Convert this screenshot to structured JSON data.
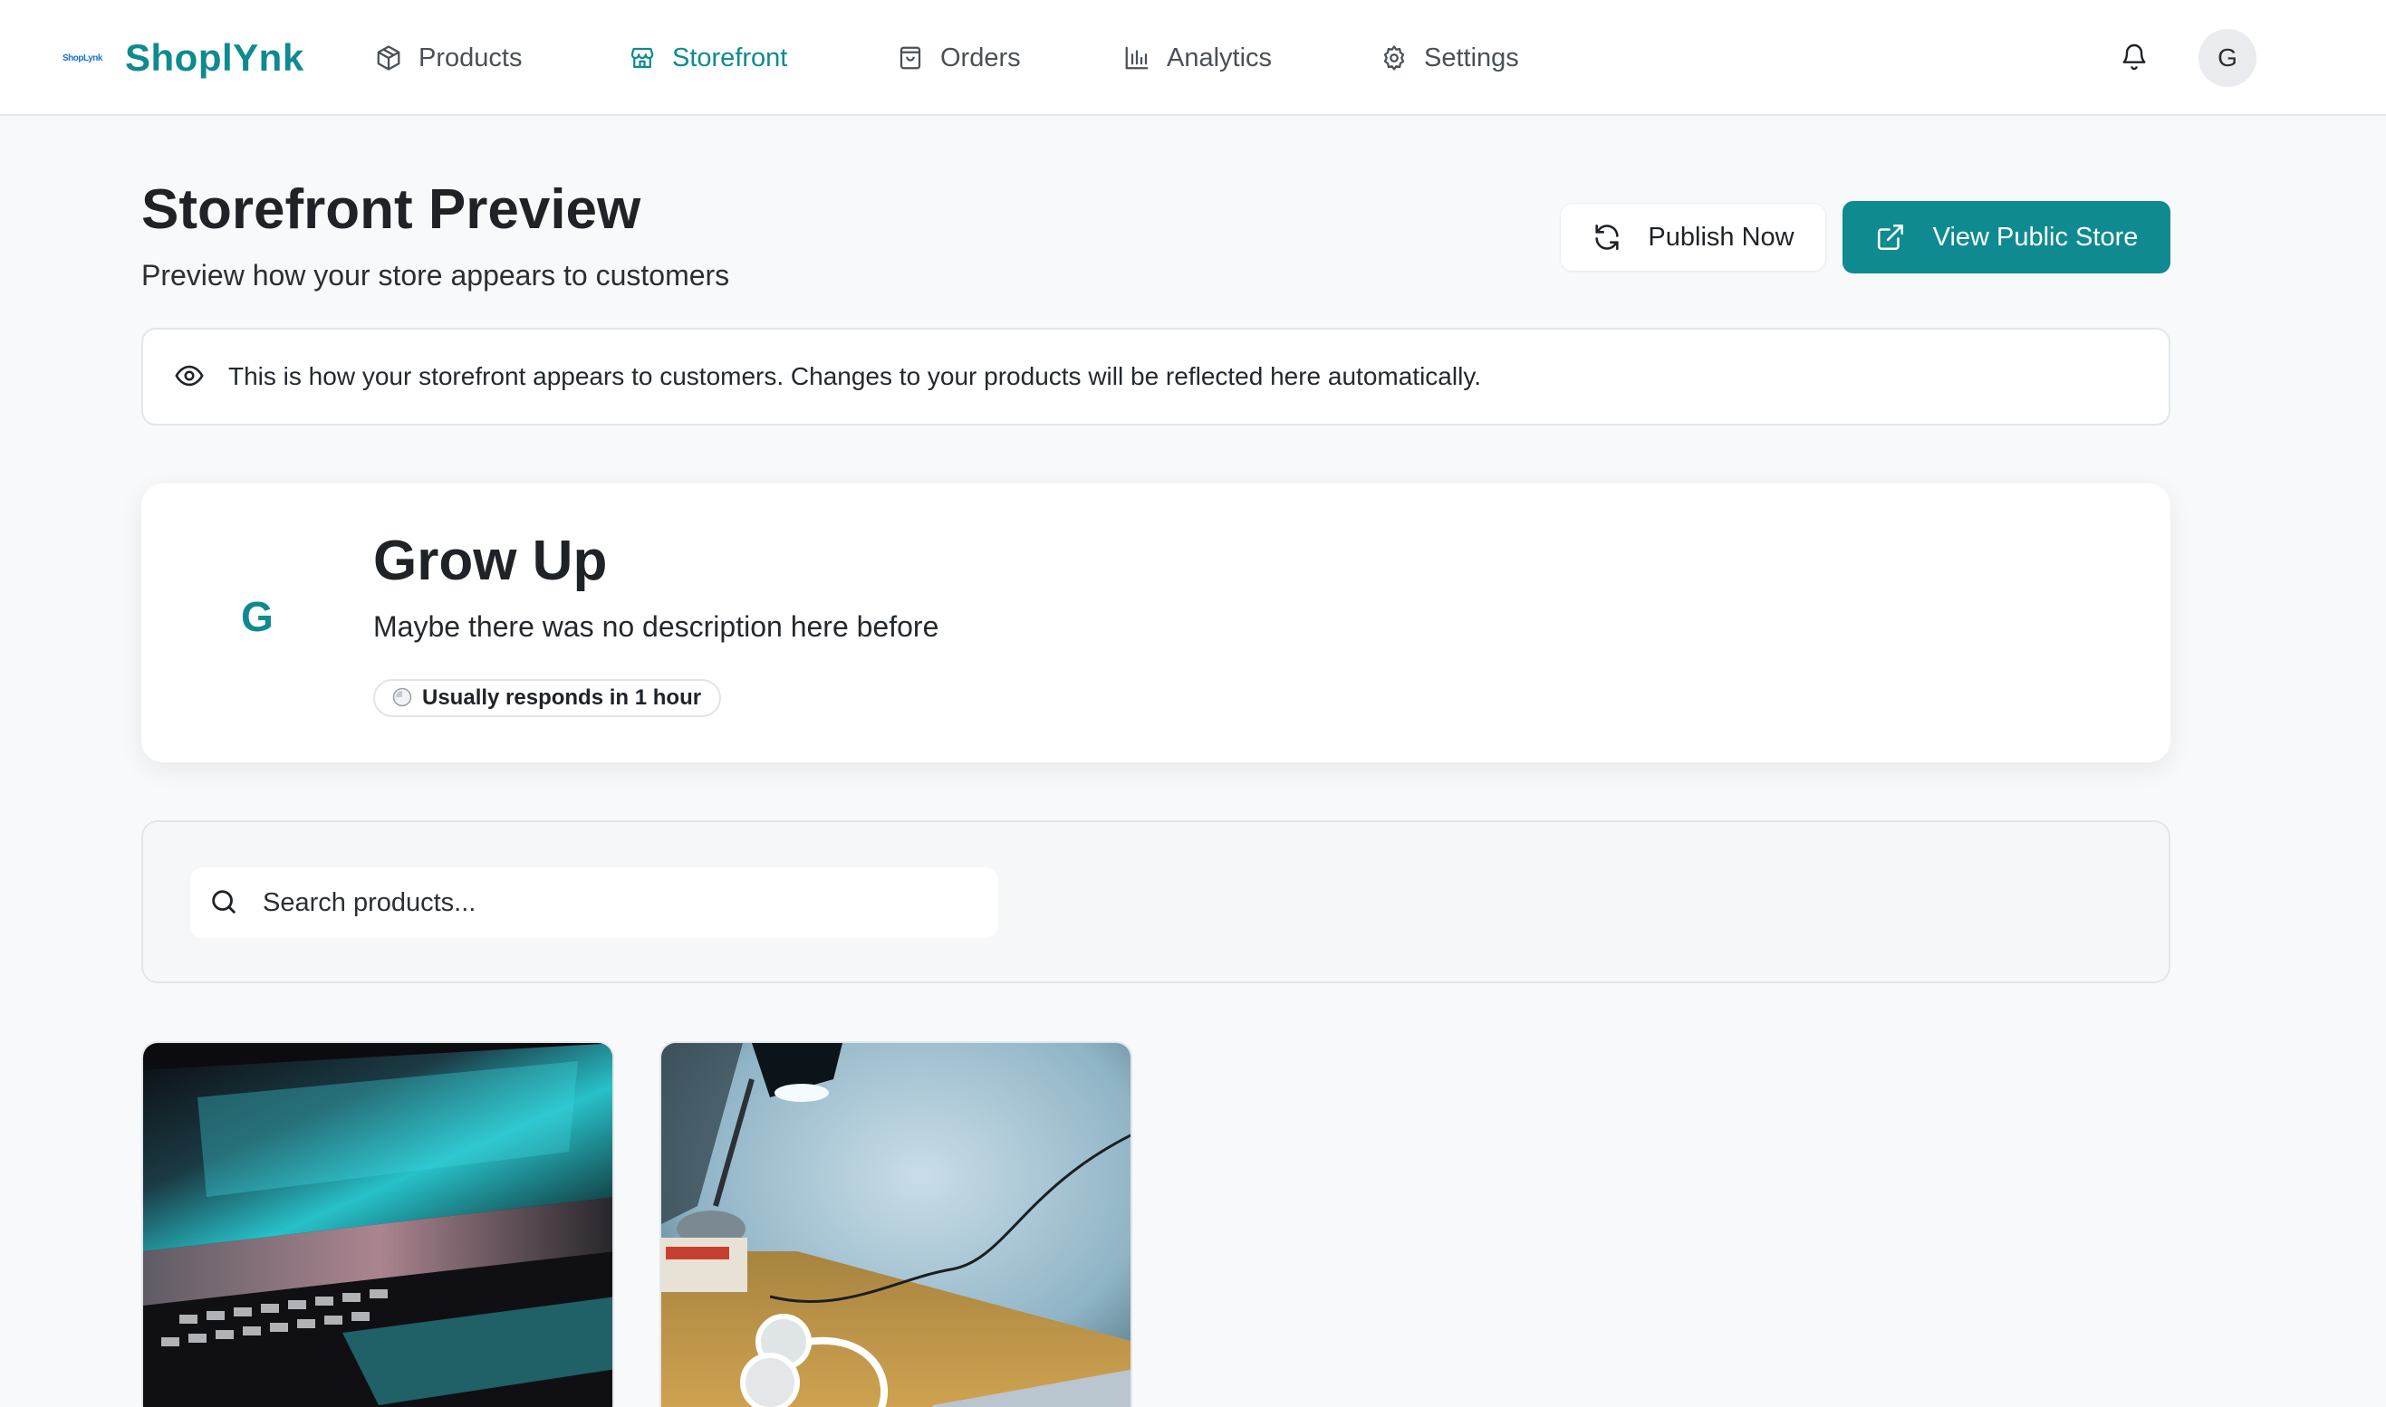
{
  "brand": {
    "name": "ShoplYnk",
    "mark": "ShopLynk"
  },
  "nav": [
    {
      "label": "Products",
      "icon": "package-icon",
      "active": false
    },
    {
      "label": "Storefront",
      "icon": "store-icon",
      "active": true
    },
    {
      "label": "Orders",
      "icon": "shopping-bag-icon",
      "active": false
    },
    {
      "label": "Analytics",
      "icon": "bar-chart-icon",
      "active": false
    },
    {
      "label": "Settings",
      "icon": "gear-icon",
      "active": false
    }
  ],
  "user": {
    "initial": "G"
  },
  "page": {
    "title": "Storefront Preview",
    "subtitle": "Preview how your store appears to customers",
    "publish_label": "Publish Now",
    "view_label": "View Public Store",
    "notice": "This is how your storefront appears to customers. Changes to your products will be reflected here automatically."
  },
  "store": {
    "initial": "G",
    "name": "Grow Up",
    "description": "Maybe there was no description here before",
    "response_badge": "Usually responds in 1 hour"
  },
  "search": {
    "placeholder": "Search products..."
  },
  "products": [
    {
      "image": "laptop-photo"
    },
    {
      "image": "desk-lamp-headphones-photo"
    }
  ],
  "colors": {
    "accent": "#0f8a91",
    "background": "#f8f9fa",
    "surface": "#ffffff",
    "border": "#e3e6e9"
  }
}
